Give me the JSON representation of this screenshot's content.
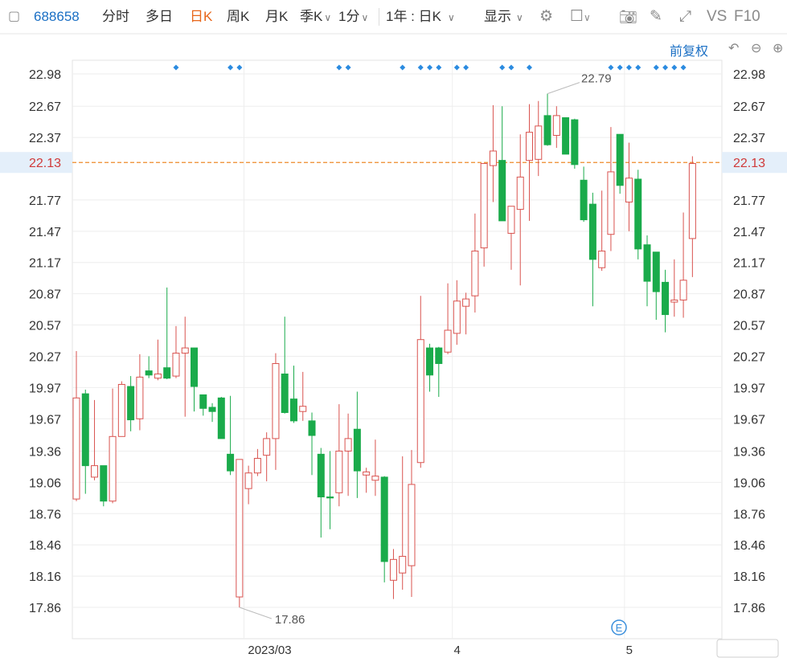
{
  "toolbar": {
    "code": "688658",
    "items": [
      "分时",
      "多日",
      "日K",
      "周K",
      "月K",
      "季K",
      "1分"
    ],
    "active": "日K",
    "range_label": "1年 : 日K",
    "display_label": "显示",
    "right_text_vs": "VS",
    "right_text_f10": "F10"
  },
  "fq_label": "前复权",
  "colors": {
    "up": "#d9534f",
    "down": "#1aab4b",
    "price_line": "#ee8a2a",
    "grid": "#eeeeee",
    "accent": "#1a6fc4"
  },
  "chart_data": {
    "type": "candlestick",
    "y_ticks": [
      22.98,
      22.67,
      22.37,
      21.77,
      21.47,
      21.17,
      20.87,
      20.57,
      20.27,
      19.97,
      19.67,
      19.36,
      19.06,
      18.76,
      18.46,
      18.16,
      17.86
    ],
    "ylim": [
      17.86,
      22.98
    ],
    "current_price": 22.13,
    "x_labels": [
      "2023/03",
      "4",
      "5"
    ],
    "max_label": "22.79",
    "min_label": "17.86",
    "event_marker": "E",
    "candles": [
      {
        "o": 18.9,
        "h": 20.32,
        "l": 18.88,
        "c": 19.87
      },
      {
        "o": 19.91,
        "h": 19.95,
        "l": 18.95,
        "c": 19.22
      },
      {
        "o": 19.11,
        "h": 19.85,
        "l": 19.08,
        "c": 19.22
      },
      {
        "o": 19.22,
        "h": 19.22,
        "l": 18.83,
        "c": 18.88
      },
      {
        "o": 18.88,
        "h": 19.96,
        "l": 18.86,
        "c": 19.5
      },
      {
        "o": 19.5,
        "h": 20.03,
        "l": 19.5,
        "c": 20.0
      },
      {
        "o": 19.98,
        "h": 20.08,
        "l": 19.55,
        "c": 19.66
      },
      {
        "o": 19.67,
        "h": 20.29,
        "l": 19.56,
        "c": 20.07
      },
      {
        "o": 20.13,
        "h": 20.27,
        "l": 20.06,
        "c": 20.09
      },
      {
        "o": 20.06,
        "h": 20.43,
        "l": 20.04,
        "c": 20.1
      },
      {
        "o": 20.16,
        "h": 20.93,
        "l": 20.05,
        "c": 20.06
      },
      {
        "o": 20.08,
        "h": 20.56,
        "l": 20.06,
        "c": 20.3
      },
      {
        "o": 20.3,
        "h": 20.65,
        "l": 19.69,
        "c": 20.35
      },
      {
        "o": 20.35,
        "h": 20.35,
        "l": 19.74,
        "c": 19.98
      },
      {
        "o": 19.9,
        "h": 19.9,
        "l": 19.7,
        "c": 19.77
      },
      {
        "o": 19.78,
        "h": 19.82,
        "l": 19.64,
        "c": 19.74
      },
      {
        "o": 19.87,
        "h": 19.88,
        "l": 19.48,
        "c": 19.48
      },
      {
        "o": 19.33,
        "h": 19.89,
        "l": 19.13,
        "c": 19.17
      },
      {
        "o": 17.96,
        "h": 19.28,
        "l": 17.86,
        "c": 19.28
      },
      {
        "o": 19.0,
        "h": 19.22,
        "l": 18.85,
        "c": 19.15
      },
      {
        "o": 19.15,
        "h": 19.38,
        "l": 19.12,
        "c": 19.29
      },
      {
        "o": 19.32,
        "h": 19.54,
        "l": 19.07,
        "c": 19.48
      },
      {
        "o": 19.48,
        "h": 20.3,
        "l": 19.18,
        "c": 20.2
      },
      {
        "o": 20.1,
        "h": 20.65,
        "l": 19.72,
        "c": 19.73
      },
      {
        "o": 19.86,
        "h": 20.18,
        "l": 19.63,
        "c": 19.65
      },
      {
        "o": 19.74,
        "h": 20.12,
        "l": 19.65,
        "c": 19.79
      },
      {
        "o": 19.65,
        "h": 19.73,
        "l": 19.13,
        "c": 19.51
      },
      {
        "o": 19.33,
        "h": 19.39,
        "l": 18.53,
        "c": 18.92
      },
      {
        "o": 18.92,
        "h": 19.36,
        "l": 18.61,
        "c": 18.91
      },
      {
        "o": 18.96,
        "h": 19.81,
        "l": 18.83,
        "c": 19.36
      },
      {
        "o": 19.36,
        "h": 19.72,
        "l": 18.93,
        "c": 19.48
      },
      {
        "o": 19.57,
        "h": 19.93,
        "l": 18.91,
        "c": 19.17
      },
      {
        "o": 19.13,
        "h": 19.2,
        "l": 18.96,
        "c": 19.16
      },
      {
        "o": 19.08,
        "h": 19.47,
        "l": 18.93,
        "c": 19.12
      },
      {
        "o": 19.11,
        "h": 19.12,
        "l": 18.1,
        "c": 18.3
      },
      {
        "o": 18.12,
        "h": 18.42,
        "l": 17.94,
        "c": 18.32
      },
      {
        "o": 18.19,
        "h": 19.31,
        "l": 18.03,
        "c": 18.35
      },
      {
        "o": 18.26,
        "h": 19.37,
        "l": 17.96,
        "c": 19.04
      },
      {
        "o": 19.25,
        "h": 20.85,
        "l": 19.2,
        "c": 20.43
      },
      {
        "o": 20.35,
        "h": 20.39,
        "l": 19.93,
        "c": 20.09
      },
      {
        "o": 20.35,
        "h": 20.36,
        "l": 19.88,
        "c": 20.2
      },
      {
        "o": 20.31,
        "h": 20.97,
        "l": 20.29,
        "c": 20.52
      },
      {
        "o": 20.49,
        "h": 21.0,
        "l": 20.38,
        "c": 20.8
      },
      {
        "o": 20.75,
        "h": 20.88,
        "l": 20.48,
        "c": 20.82
      },
      {
        "o": 20.85,
        "h": 21.64,
        "l": 20.69,
        "c": 21.28
      },
      {
        "o": 21.31,
        "h": 22.12,
        "l": 21.13,
        "c": 22.12
      },
      {
        "o": 22.1,
        "h": 22.68,
        "l": 21.75,
        "c": 22.24
      },
      {
        "o": 22.15,
        "h": 22.67,
        "l": 21.59,
        "c": 21.57
      },
      {
        "o": 21.45,
        "h": 21.68,
        "l": 21.1,
        "c": 21.71
      },
      {
        "o": 21.68,
        "h": 22.4,
        "l": 20.95,
        "c": 21.99
      },
      {
        "o": 22.15,
        "h": 22.69,
        "l": 21.57,
        "c": 22.42
      },
      {
        "o": 22.16,
        "h": 22.72,
        "l": 22.0,
        "c": 22.48
      },
      {
        "o": 22.58,
        "h": 22.79,
        "l": 22.29,
        "c": 22.3
      },
      {
        "o": 22.39,
        "h": 22.67,
        "l": 22.27,
        "c": 22.58
      },
      {
        "o": 22.56,
        "h": 22.56,
        "l": 22.21,
        "c": 22.21
      },
      {
        "o": 22.54,
        "h": 22.55,
        "l": 22.07,
        "c": 22.11
      },
      {
        "o": 21.96,
        "h": 22.09,
        "l": 21.56,
        "c": 21.58
      },
      {
        "o": 21.73,
        "h": 21.84,
        "l": 20.75,
        "c": 21.2
      },
      {
        "o": 21.12,
        "h": 21.86,
        "l": 21.09,
        "c": 21.28
      },
      {
        "o": 21.44,
        "h": 22.47,
        "l": 21.28,
        "c": 22.04
      },
      {
        "o": 22.4,
        "h": 22.4,
        "l": 21.83,
        "c": 21.91
      },
      {
        "o": 21.75,
        "h": 22.32,
        "l": 21.47,
        "c": 21.98
      },
      {
        "o": 21.97,
        "h": 22.06,
        "l": 21.2,
        "c": 21.3
      },
      {
        "o": 21.34,
        "h": 21.43,
        "l": 20.75,
        "c": 20.99
      },
      {
        "o": 21.27,
        "h": 21.27,
        "l": 20.62,
        "c": 20.89
      },
      {
        "o": 20.98,
        "h": 21.1,
        "l": 20.5,
        "c": 20.67
      },
      {
        "o": 20.79,
        "h": 21.2,
        "l": 20.65,
        "c": 20.81
      },
      {
        "o": 20.81,
        "h": 21.65,
        "l": 20.64,
        "c": 21.0
      },
      {
        "o": 21.4,
        "h": 22.19,
        "l": 21.03,
        "c": 22.12
      }
    ]
  }
}
